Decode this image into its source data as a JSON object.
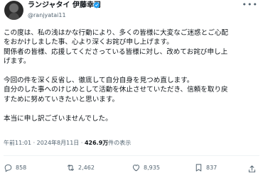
{
  "post": {
    "author_name": "ランジャタイ 伊藤幸司",
    "handle": "@ranjyatai11",
    "paragraph1": [
      "この度は、私の浅はかな行動により、多くの皆様に大変なご迷惑とご心配",
      "をおかけしました事、心より深くお詫び申し上げます。",
      "関係者の皆様、応援してくださっている皆様に対し、改めてお詫び申し上",
      "げます。"
    ],
    "paragraph2": [
      "今回の件を深く反省し、徹底して自分自身を見つめ直します。",
      "自分のした事へのけじめとして活動を休止させていただき、信頼を取り戻",
      "すために努めていきたいと思います。"
    ],
    "paragraph3": [
      "本当に申し訳ございませんでした。"
    ],
    "timestamp": "午前11:01 · 2024年8月11日 ·",
    "views_count": "426.9万",
    "views_label": "件の表示"
  },
  "actions": {
    "replies": "858",
    "reposts": "2,462",
    "likes": "8,935",
    "bookmarks": "837"
  },
  "colors": {
    "text": "#0f1419",
    "secondary": "#536471",
    "verified": "#1d9bf0"
  }
}
